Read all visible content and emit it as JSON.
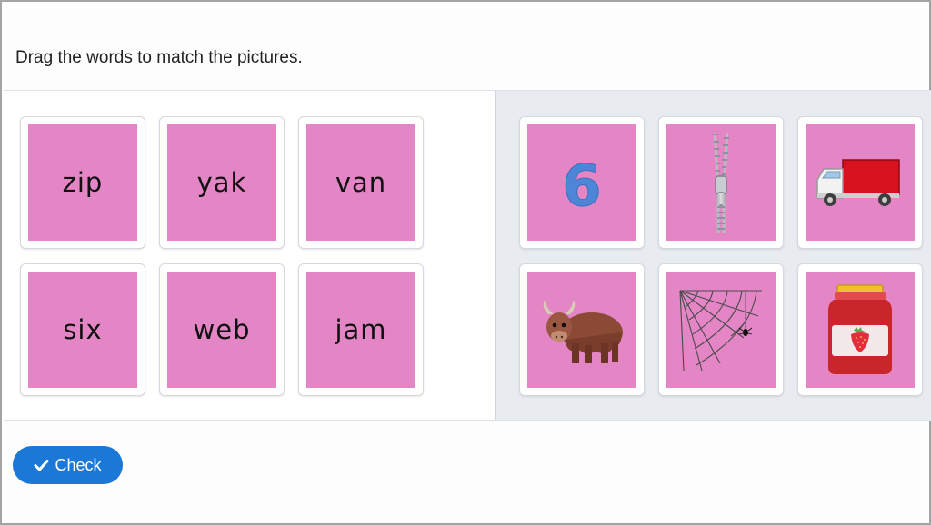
{
  "instruction": "Drag the words to match the pictures.",
  "words": [
    "zip",
    "yak",
    "van",
    "six",
    "web",
    "jam"
  ],
  "pictures": [
    {
      "icon": "six-number-icon",
      "text": "6"
    },
    {
      "icon": "zipper-icon"
    },
    {
      "icon": "van-icon"
    },
    {
      "icon": "yak-icon"
    },
    {
      "icon": "spider-web-icon"
    },
    {
      "icon": "jam-jar-icon"
    }
  ],
  "check_button": {
    "label": "Check",
    "icon": "checkmark-icon"
  },
  "colors": {
    "card_fill": "#e485c6",
    "button": "#1b78d6"
  }
}
